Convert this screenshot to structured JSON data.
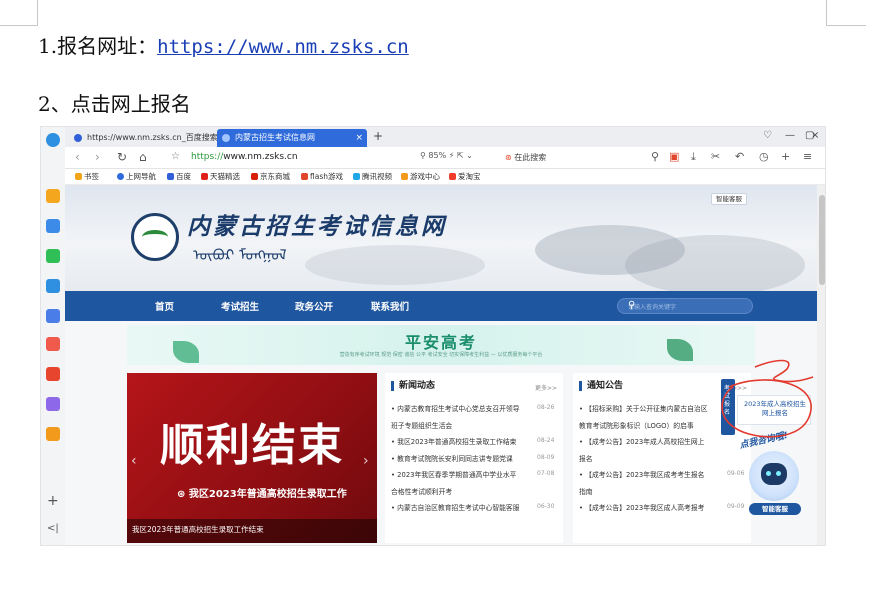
{
  "doc": {
    "line1_prefix": "1.报名网址：",
    "line1_link": "https://www.nm.zsks.cn",
    "line2": "2、点击网上报名"
  },
  "browser": {
    "tabs": [
      {
        "label": "https://www.nm.zsks.cn_百度搜索",
        "active": false
      },
      {
        "label": "内蒙古招生考试信息网",
        "active": true
      }
    ],
    "newtab_icon": "plus-icon",
    "url_scheme": "https://",
    "url_host": "www.nm.zsks.cn",
    "zoom": "85%",
    "search_placeholder": "在此搜索",
    "bookmarks": [
      {
        "label": "书签",
        "color": "#f2a516"
      },
      {
        "label": "上网导航",
        "color": "#2f6bdb"
      },
      {
        "label": "百度",
        "color": "#3160d8"
      },
      {
        "label": "天猫精选",
        "color": "#e0211b"
      },
      {
        "label": "京东商城",
        "color": "#d81e06"
      },
      {
        "label": "flash游戏",
        "color": "#e0462b"
      },
      {
        "label": "腾讯视频",
        "color": "#20a7e8"
      },
      {
        "label": "游戏中心",
        "color": "#f29a1c"
      },
      {
        "label": "爱淘宝",
        "color": "#f03c2b"
      }
    ]
  },
  "site": {
    "title": "内蒙古招生考试信息网",
    "mongolian": "ᠥᠪᠥᠷ ᠮᠣᠩᠭᠣᠯ",
    "service_btn": "智能客服",
    "nav": [
      "首页",
      "考试招生",
      "政务公开",
      "联系我们"
    ],
    "search_placeholder": "请输入查询关键字",
    "safe_title": "平安高考",
    "safe_sub": "营造有序考试环境  规范  保密  诚信  公平  考试安全  切实保障考生利益 — 以优质服务每个平台",
    "slide": {
      "title": "顺利结束",
      "subtitle": "我区2023年普通高校招生录取工作",
      "caption": "我区2023年普通高校招生录取工作结束"
    },
    "news": {
      "title": "新闻动态",
      "more": "更多>>",
      "items": [
        {
          "text": "内蒙古教育招生考试中心党总支召开领导",
          "date": "08-26"
        },
        {
          "text": "班子专题组织生活会",
          "date": ""
        },
        {
          "text": "我区2023年普通高校招生录取工作结束",
          "date": "08-24"
        },
        {
          "text": "教育考试院院长安利同同志讲专题党课",
          "date": "08-09"
        },
        {
          "text": "2023年我区春季学期普通高中学业水平",
          "date": "07-08"
        },
        {
          "text": "合格性考试顺利开考",
          "date": ""
        },
        {
          "text": "内蒙古自治区教育招生考试中心智能客服",
          "date": "06-30"
        }
      ]
    },
    "notice": {
      "title": "通知公告",
      "more": "更多>>",
      "items": [
        {
          "text": "【招标采购】关于公开征集内蒙古自治区",
          "date": ""
        },
        {
          "text": "教育考试院形象标识（LOGO）的启事",
          "date": ""
        },
        {
          "text": "【成考公告】2023年成人高校招生网上",
          "date": ""
        },
        {
          "text": "报名",
          "date": ""
        },
        {
          "text": "【成考公告】2023年我区成考考生报名",
          "date": "09-06"
        },
        {
          "text": "指南",
          "date": ""
        },
        {
          "text": "【成考公告】2023年我区成人高考报考",
          "date": "09-09"
        }
      ]
    },
    "float_tab": "考试报名",
    "float_box": "2023年成人高校招生网上报名",
    "robot_callout": "点我咨询哦!",
    "robot_label": "智能客服"
  }
}
